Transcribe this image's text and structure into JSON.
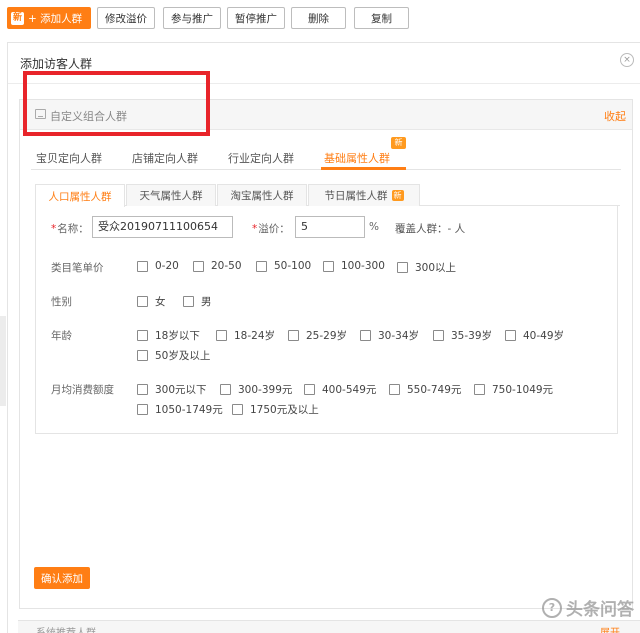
{
  "toolbar": {
    "add_badge": "新",
    "add_label": "+ 添加人群",
    "modify_premium": "修改溢价",
    "join_promo": "参与推广",
    "pause_promo": "暂停推广",
    "delete": "删除",
    "copy": "复制"
  },
  "panel": {
    "title": "添加访客人群",
    "close": "×",
    "section_title": "自定义组合人群",
    "collapse": "收起"
  },
  "tabs_level1": [
    {
      "label": "宝贝定向人群",
      "active": false
    },
    {
      "label": "店铺定向人群",
      "active": false
    },
    {
      "label": "行业定向人群",
      "active": false
    },
    {
      "label": "基础属性人群",
      "active": true,
      "badge": "新"
    }
  ],
  "tabs_level2": [
    {
      "label": "人口属性人群",
      "active": true
    },
    {
      "label": "天气属性人群",
      "active": false
    },
    {
      "label": "淘宝属性人群",
      "active": false
    },
    {
      "label": "节日属性人群",
      "active": false,
      "badge": "新"
    }
  ],
  "form": {
    "name_label": "名称：",
    "name_value": "受众20190711100654",
    "premium_label": "溢价：",
    "premium_value": "5",
    "premium_unit": "%",
    "coverage_label": "覆盖人群：",
    "coverage_value": "- 人",
    "category_label": "类目笔单价",
    "category_options": [
      "0-20",
      "20-50",
      "50-100",
      "100-300",
      "300以上"
    ],
    "gender_label": "性别",
    "gender_options": [
      "女",
      "男"
    ],
    "age_label": "年龄",
    "age_options": [
      "18岁以下",
      "18-24岁",
      "25-29岁",
      "30-34岁",
      "35-39岁",
      "40-49岁",
      "50岁及以上"
    ],
    "spend_label": "月均消费额度",
    "spend_options": [
      "300元以下",
      "300-399元",
      "400-549元",
      "550-749元",
      "750-1049元",
      "1050-1749元",
      "1750元及以上"
    ]
  },
  "confirm_button": "确认添加",
  "next_section": {
    "label": "系统推荐人群",
    "action": "展开"
  },
  "watermark": "头条问答",
  "colors": {
    "accent": "#ff7e14",
    "highlight_box": "#e8242a"
  }
}
